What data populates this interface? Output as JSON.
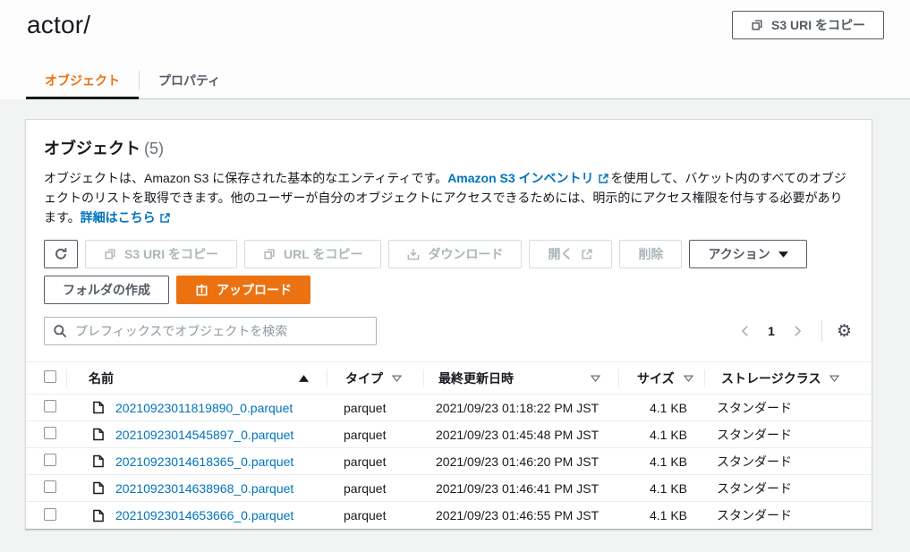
{
  "page": {
    "title": "actor/",
    "copy_s3_uri_top_label": "S3 URI をコピー"
  },
  "tabs": {
    "objects": "オブジェクト",
    "properties": "プロパティ"
  },
  "panel": {
    "heading": "オブジェクト",
    "count": "(5)",
    "description": {
      "part1": "オブジェクトは、Amazon S3 に保存された基本的なエンティティです。",
      "link1": "Amazon S3 インベントリ",
      "part2": "を使用して、バケット内のすべてのオブジェクトのリストを取得できます。他のユーザーが自分のオブジェクトにアクセスできるためには、明示的にアクセス権限を付与する必要があります。",
      "link2": "詳細はこちら"
    },
    "toolbar": {
      "copy_s3_uri": "S3 URI をコピー",
      "copy_url": "URL をコピー",
      "download": "ダウンロード",
      "open": "開く",
      "delete": "削除",
      "actions": "アクション",
      "create_folder": "フォルダの作成",
      "upload": "アップロード"
    },
    "search_placeholder": "プレフィックスでオブジェクトを検索",
    "pagination": {
      "current_page": "1"
    },
    "table": {
      "columns": [
        "名前",
        "タイプ",
        "最終更新日時",
        "サイズ",
        "ストレージクラス"
      ],
      "rows": [
        {
          "name": "20210923011819890_0.parquet",
          "type": "parquet",
          "modified": "2021/09/23 01:18:22 PM JST",
          "size": "4.1 KB",
          "storage_class": "スタンダード"
        },
        {
          "name": "20210923014545897_0.parquet",
          "type": "parquet",
          "modified": "2021/09/23 01:45:48 PM JST",
          "size": "4.1 KB",
          "storage_class": "スタンダード"
        },
        {
          "name": "20210923014618365_0.parquet",
          "type": "parquet",
          "modified": "2021/09/23 01:46:20 PM JST",
          "size": "4.1 KB",
          "storage_class": "スタンダード"
        },
        {
          "name": "20210923014638968_0.parquet",
          "type": "parquet",
          "modified": "2021/09/23 01:46:41 PM JST",
          "size": "4.1 KB",
          "storage_class": "スタンダード"
        },
        {
          "name": "20210923014653666_0.parquet",
          "type": "parquet",
          "modified": "2021/09/23 01:46:55 PM JST",
          "size": "4.1 KB",
          "storage_class": "スタンダード"
        }
      ]
    }
  },
  "colors": {
    "accent_orange": "#ec7211",
    "link_blue": "#0073bb",
    "text_dark": "#16191f",
    "text_secondary": "#545b64",
    "disabled_gray": "#aab7b8"
  }
}
